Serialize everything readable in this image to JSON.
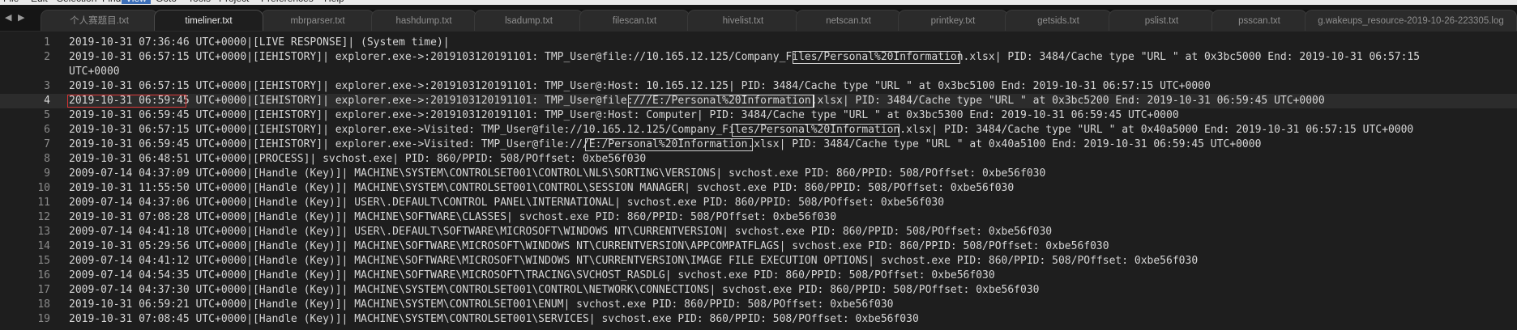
{
  "menu": [
    "File",
    "Edit",
    "Selection",
    "Find",
    "View",
    "Goto",
    "Tools",
    "Project",
    "Preferences",
    "Help"
  ],
  "menu_active": "View",
  "nav": {
    "back": "◀",
    "forward": "▶"
  },
  "tabs": [
    {
      "label": "个人赛题目.txt",
      "active": false
    },
    {
      "label": "timeliner.txt",
      "active": true
    },
    {
      "label": "mbrparser.txt",
      "active": false
    },
    {
      "label": "hashdump.txt",
      "active": false
    },
    {
      "label": "lsadump.txt",
      "active": false
    },
    {
      "label": "filescan.txt",
      "active": false
    },
    {
      "label": "hivelist.txt",
      "active": false
    },
    {
      "label": "netscan.txt",
      "active": false
    },
    {
      "label": "printkey.txt",
      "active": false
    },
    {
      "label": "getsids.txt",
      "active": false
    },
    {
      "label": "pslist.txt",
      "active": false
    },
    {
      "label": "psscan.txt",
      "active": false
    },
    {
      "label": "g.wakeups_resource-2019-10-26-223305.log",
      "active": false
    }
  ],
  "lines": [
    {
      "num": "1",
      "text": "2019-10-31 07:36:46 UTC+0000|[LIVE RESPONSE]| (System time)|"
    },
    {
      "num": "2",
      "text": "2019-10-31 06:57:15 UTC+0000|[IEHISTORY]| explorer.exe->:2019103120191101: TMP_User@file://10.165.12.125/Company_Files/Personal%20Information.xlsx| PID: 3484/Cache type \"URL \" at 0x3bc5000 End: 2019-10-31 06:57:15"
    },
    {
      "num": "",
      "text": "UTC+0000"
    },
    {
      "num": "3",
      "text": "2019-10-31 06:57:15 UTC+0000|[IEHISTORY]| explorer.exe->:2019103120191101: TMP_User@:Host: 10.165.12.125| PID: 3484/Cache type \"URL \" at 0x3bc5100 End: 2019-10-31 06:57:15 UTC+0000"
    },
    {
      "num": "4",
      "text": "2019-10-31 06:59:45 UTC+0000|[IEHISTORY]| explorer.exe->:2019103120191101: TMP_User@file:///E:/Personal%20Information.xlsx| PID: 3484/Cache type \"URL \" at 0x3bc5200 End: 2019-10-31 06:59:45 UTC+0000"
    },
    {
      "num": "5",
      "text": "2019-10-31 06:59:45 UTC+0000|[IEHISTORY]| explorer.exe->:2019103120191101: TMP_User@:Host: Computer| PID: 3484/Cache type \"URL \" at 0x3bc5300 End: 2019-10-31 06:59:45 UTC+0000"
    },
    {
      "num": "6",
      "text": "2019-10-31 06:57:15 UTC+0000|[IEHISTORY]| explorer.exe->Visited: TMP_User@file://10.165.12.125/Company_Files/Personal%20Information.xlsx| PID: 3484/Cache type \"URL \" at 0x40a5000 End: 2019-10-31 06:57:15 UTC+0000"
    },
    {
      "num": "7",
      "text": "2019-10-31 06:59:45 UTC+0000|[IEHISTORY]| explorer.exe->Visited: TMP_User@file:///E:/Personal%20Information.xlsx| PID: 3484/Cache type \"URL \" at 0x40a5100 End: 2019-10-31 06:59:45 UTC+0000"
    },
    {
      "num": "8",
      "text": "2019-10-31 06:48:51 UTC+0000|[PROCESS]| svchost.exe| PID: 860/PPID: 508/POffset: 0xbe56f030"
    },
    {
      "num": "9",
      "text": "2009-07-14 04:37:09 UTC+0000|[Handle (Key)]| MACHINE\\SYSTEM\\CONTROLSET001\\CONTROL\\NLS\\SORTING\\VERSIONS| svchost.exe PID: 860/PPID: 508/POffset: 0xbe56f030"
    },
    {
      "num": "10",
      "text": "2019-10-31 11:55:50 UTC+0000|[Handle (Key)]| MACHINE\\SYSTEM\\CONTROLSET001\\CONTROL\\SESSION MANAGER| svchost.exe PID: 860/PPID: 508/POffset: 0xbe56f030"
    },
    {
      "num": "11",
      "text": "2009-07-14 04:37:06 UTC+0000|[Handle (Key)]| USER\\.DEFAULT\\CONTROL PANEL\\INTERNATIONAL| svchost.exe PID: 860/PPID: 508/POffset: 0xbe56f030"
    },
    {
      "num": "12",
      "text": "2019-10-31 07:08:28 UTC+0000|[Handle (Key)]| MACHINE\\SOFTWARE\\CLASSES| svchost.exe PID: 860/PPID: 508/POffset: 0xbe56f030"
    },
    {
      "num": "13",
      "text": "2009-07-14 04:41:18 UTC+0000|[Handle (Key)]| USER\\.DEFAULT\\SOFTWARE\\MICROSOFT\\WINDOWS NT\\CURRENTVERSION| svchost.exe PID: 860/PPID: 508/POffset: 0xbe56f030"
    },
    {
      "num": "14",
      "text": "2019-10-31 05:29:56 UTC+0000|[Handle (Key)]| MACHINE\\SOFTWARE\\MICROSOFT\\WINDOWS NT\\CURRENTVERSION\\APPCOMPATFLAGS| svchost.exe PID: 860/PPID: 508/POffset: 0xbe56f030"
    },
    {
      "num": "15",
      "text": "2009-07-14 04:41:12 UTC+0000|[Handle (Key)]| MACHINE\\SOFTWARE\\MICROSOFT\\WINDOWS NT\\CURRENTVERSION\\IMAGE FILE EXECUTION OPTIONS| svchost.exe PID: 860/PPID: 508/POffset: 0xbe56f030"
    },
    {
      "num": "16",
      "text": "2009-07-14 04:54:35 UTC+0000|[Handle (Key)]| MACHINE\\SOFTWARE\\MICROSOFT\\TRACING\\SVCHOST_RASDLG| svchost.exe PID: 860/PPID: 508/POffset: 0xbe56f030"
    },
    {
      "num": "17",
      "text": "2009-07-14 04:37:30 UTC+0000|[Handle (Key)]| MACHINE\\SYSTEM\\CONTROLSET001\\CONTROL\\NETWORK\\CONNECTIONS| svchost.exe PID: 860/PPID: 508/POffset: 0xbe56f030"
    },
    {
      "num": "18",
      "text": "2019-10-31 06:59:21 UTC+0000|[Handle (Key)]| MACHINE\\SYSTEM\\CONTROLSET001\\ENUM| svchost.exe PID: 860/PPID: 508/POffset: 0xbe56f030"
    },
    {
      "num": "19",
      "text": "2019-10-31 07:08:45 UTC+0000|[Handle (Key)]| MACHINE\\SYSTEM\\CONTROLSET001\\SERVICES| svchost.exe PID: 860/PPID: 508/POffset: 0xbe56f030"
    }
  ],
  "current_line": "4",
  "colors": {
    "background": "#1e1e1e",
    "current_line": "#2c2c2c",
    "highlight_box": "#cfcfcf",
    "selection_box_red": "#d83232"
  }
}
